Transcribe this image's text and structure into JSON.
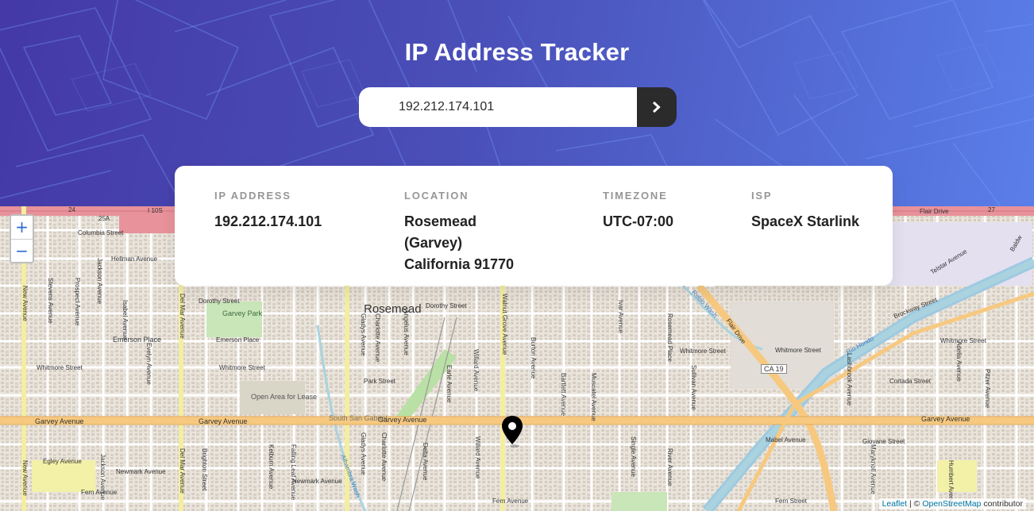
{
  "header": {
    "title": "IP Address Tracker"
  },
  "search": {
    "value": "192.212.174.101",
    "submit_icon": "chevron-right-icon"
  },
  "info": {
    "ip_label": "IP ADDRESS",
    "ip_value": "192.212.174.101",
    "location_label": "LOCATION",
    "location_lines": [
      "Rosemead",
      "(Garvey)",
      "California 91770"
    ],
    "timezone_label": "TIMEZONE",
    "timezone_value": "UTC-07:00",
    "isp_label": "ISP",
    "isp_value": "SpaceX Starlink"
  },
  "map": {
    "zoom_in": "+",
    "zoom_out": "−",
    "attribution": {
      "leaflet": "Leaflet",
      "separator": "| ©",
      "osm": "OpenStreetMap",
      "suffix": "contributor"
    },
    "labels": {
      "rosemead": "Rosemead",
      "garvey_park": "Garvey Park",
      "open_area": "Open Area for Lease",
      "south_san_gabriel": "South San Gabriel",
      "garvey_ave_1": "Garvey Avenue",
      "garvey_ave_2": "Garvey Avenue",
      "garvey_ave_3": "Garvey Avenue",
      "garvey_ave_4": "Garvey Avenue",
      "hellman_ave": "Hellman Avenue",
      "columbia_st": "Columbia Street",
      "dorothy_st_1": "Dorothy Street",
      "dorothy_st_2": "Dorothy Street",
      "emerson_place_1": "Emerson Place",
      "emerson_place_2": "Emerson Place",
      "whitmore_st_1": "Whitmore Street",
      "whitmore_st_2": "Whitmore Street",
      "whitmore_st_3": "Whitmore Street",
      "whitmore_st_4": "Whitmore Street",
      "whitmore_st_5": "Whitmore Street",
      "park_st": "Park Street",
      "egley_ave": "Egley Avenue",
      "newmark_ave_1": "Newmark Avenue",
      "newmark_ave_2": "Newmark Avenue",
      "fern_ave_1": "Fern Avenue",
      "fern_ave_2": "Fern Avenue",
      "fern_st": "Fern Street",
      "mabel_ave": "Mabel Avenue",
      "giovane_st": "Giovane Street",
      "cortada_st": "Cortada Street",
      "telstar_ave": "Telstar Avenue",
      "flair_drive_1": "Flair Drive",
      "flair_drive_2": "Flair Drive",
      "brockway_st": "Brockway Street",
      "rio_hondo_1": "Rio Hondo",
      "rio_hondo_2": "Rio Hondo",
      "ca19": "CA 19",
      "i10s": "I 10S",
      "shield_24": "24",
      "shield_25a": "25A",
      "shield_27": "27",
      "walnut_grove": "Walnut Grove Avenue",
      "del_mar_1": "Del Mar Avenue",
      "del_mar_2": "Del Mar Avenue",
      "new_ave_1": "New Avenue",
      "new_ave_2": "New Avenue",
      "rosemead_place": "Rosemead Place",
      "ivar_ave": "Ivar Avenue",
      "muscatel_ave": "Muscatel Avenue",
      "burton_ave": "Burton Avenue",
      "bartlett_ave": "Bartlett Avenue",
      "willard_ave_1": "Willard Avenue",
      "willard_ave_2": "Willard Avenue",
      "earle_ave": "Earle Avenue",
      "charlotte_ave_1": "Charlotte Avenue",
      "charlotte_ave_2": "Charlotte Avenue",
      "gladys_ave_1": "Gladys Avenue",
      "gladys_ave_2": "Gladys Avenue",
      "angelus_ave": "Angelus Avenue",
      "delta_ave": "Delta Avenue",
      "jackson_ave_1": "Jackson Avenue",
      "jackson_ave_2": "Jackson Avenue",
      "stevens_ave": "Stevens Avenue",
      "prospect_ave": "Prospect Avenue",
      "isabel_ave": "Isabel Avenue",
      "evelyn_ave": "Evelyn Avenue",
      "brighton_st": "Brighton Street",
      "kelburn_ave": "Kelburn Avenue",
      "falling_leaf": "Falling Leaf Avenue",
      "single_ave": "Single Avenue",
      "river_ave": "River Avenue",
      "sullivan_ave": "Sullivan Avenue",
      "lashbrook_ave": "Lashbrook Avenue",
      "adelia_ave": "Adelia Avenue",
      "pitzer_ave": "Pitzer Avenue",
      "humbert_ave": "Humbert Avenue",
      "maryknoll_ave": "Maryknoll Avenue",
      "baldwin": "Baldw",
      "sinclair": "Sinclair",
      "alhambra_wash": "Alhambra Wash",
      "rubio_wash": "Rubio Wash"
    }
  },
  "colors": {
    "header_start": "#4439a6",
    "header_end": "#5a7ee8",
    "button_dark": "#2b2b2b",
    "label_gray": "#969696",
    "value_dark": "#222222",
    "major_road": "#f7c980",
    "secondary_road": "#f4eea0",
    "freeway": "#e8929b"
  }
}
